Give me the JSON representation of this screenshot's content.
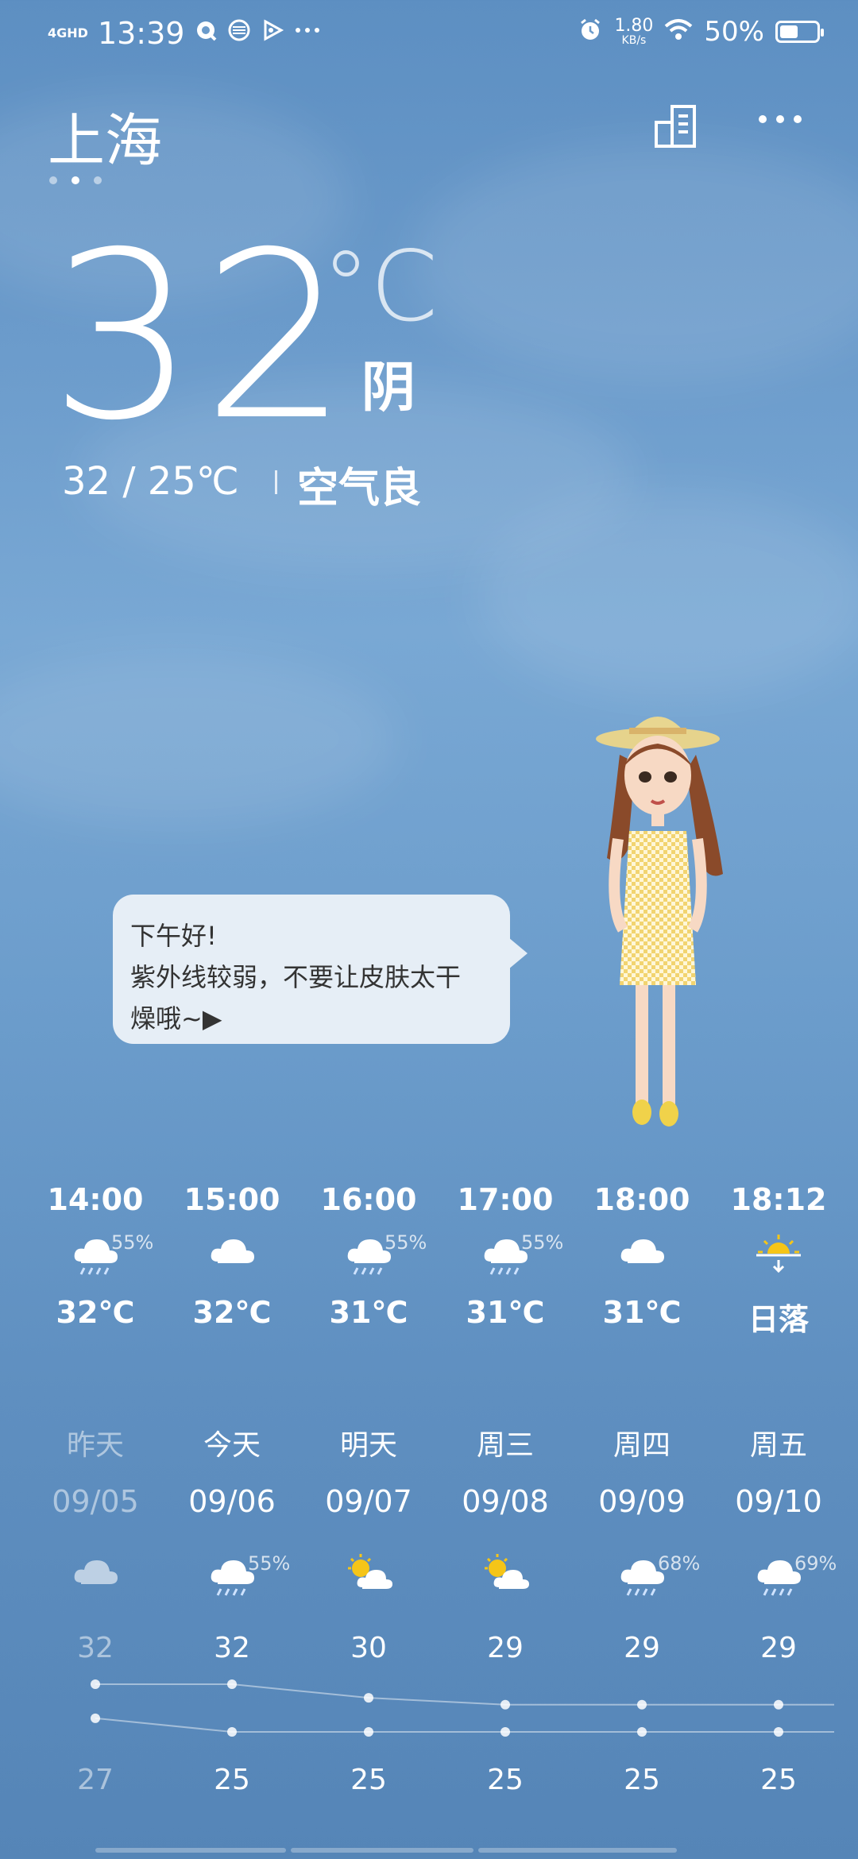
{
  "status_bar": {
    "network": "4GHD",
    "time": "13:39",
    "speed_value": "1.80",
    "speed_unit": "KB/s",
    "battery": "50%",
    "battery_level": 0.5
  },
  "header": {
    "city": "上海",
    "page_count": 3,
    "active_page": 2
  },
  "current": {
    "temp": "32",
    "unit": "°C",
    "condition": "阴",
    "range": "32  /  25℃",
    "air_quality": "空气良"
  },
  "bubble": {
    "line1": "下午好!",
    "line2": "紫外线较弱，不要让皮肤太干",
    "line3": "燥哦~▶"
  },
  "hourly": [
    {
      "time": "14:00",
      "icon": "cloud-rain-icon",
      "pct": "55%",
      "temp": "32℃"
    },
    {
      "time": "15:00",
      "icon": "cloud-icon",
      "pct": "",
      "temp": "32℃"
    },
    {
      "time": "16:00",
      "icon": "cloud-rain-icon",
      "pct": "55%",
      "temp": "31℃"
    },
    {
      "time": "17:00",
      "icon": "cloud-rain-icon",
      "pct": "55%",
      "temp": "31℃"
    },
    {
      "time": "18:00",
      "icon": "cloud-icon",
      "pct": "",
      "temp": "31℃"
    },
    {
      "time": "18:12",
      "icon": "sunset-icon",
      "pct": "",
      "temp": "日落"
    }
  ],
  "daily": [
    {
      "name": "昨天",
      "date": "09/05",
      "icon": "cloud-icon",
      "pct": "",
      "hi": "32",
      "lo": "27",
      "past": true
    },
    {
      "name": "今天",
      "date": "09/06",
      "icon": "cloud-rain-icon",
      "pct": "55%",
      "hi": "32",
      "lo": "25",
      "past": false
    },
    {
      "name": "明天",
      "date": "09/07",
      "icon": "partly-cloudy-icon",
      "pct": "",
      "hi": "30",
      "lo": "25",
      "past": false
    },
    {
      "name": "周三",
      "date": "09/08",
      "icon": "partly-cloudy-icon",
      "pct": "",
      "hi": "29",
      "lo": "25",
      "past": false
    },
    {
      "name": "周四",
      "date": "09/09",
      "icon": "cloud-rain-icon",
      "pct": "68%",
      "hi": "29",
      "lo": "25",
      "past": false
    },
    {
      "name": "周五",
      "date": "09/10",
      "icon": "cloud-rain-icon",
      "pct": "69%",
      "hi": "29",
      "lo": "25",
      "past": false
    }
  ],
  "colors": {
    "sun": "#f5c518",
    "bubble_bg": "#e6eef6"
  }
}
